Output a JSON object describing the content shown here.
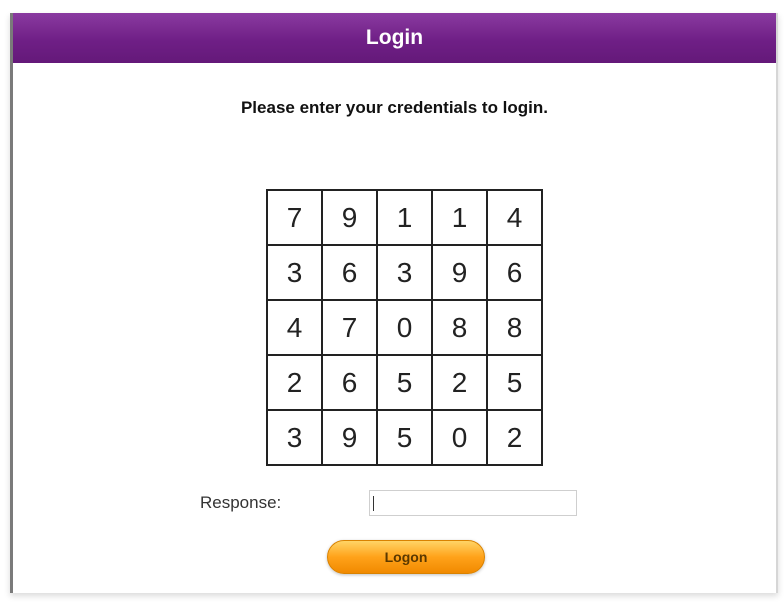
{
  "header": {
    "title": "Login"
  },
  "instruction": "Please enter your credentials to login.",
  "grid": {
    "rows": [
      [
        "7",
        "9",
        "1",
        "1",
        "4"
      ],
      [
        "3",
        "6",
        "3",
        "9",
        "6"
      ],
      [
        "4",
        "7",
        "0",
        "8",
        "8"
      ],
      [
        "2",
        "6",
        "5",
        "2",
        "5"
      ],
      [
        "3",
        "9",
        "5",
        "0",
        "2"
      ]
    ]
  },
  "form": {
    "response_label": "Response:",
    "response_value": "",
    "logon_label": "Logon"
  },
  "colors": {
    "header_purple": "#6f1f86",
    "button_orange": "#ffa21a"
  }
}
